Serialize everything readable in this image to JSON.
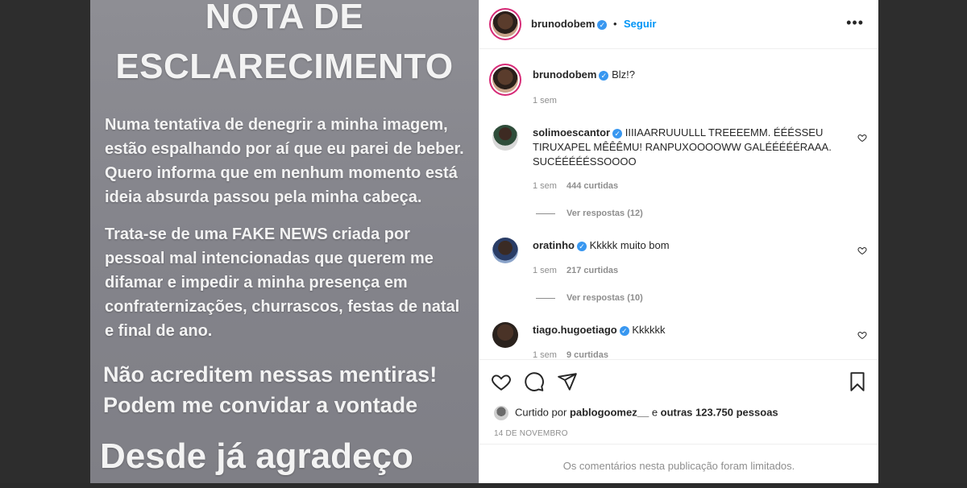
{
  "story": {
    "title_line1": "NOTA DE",
    "title_line2": "ESCLARECIMENTO",
    "paragraph1": "Numa tentativa de denegrir a minha imagem, estão espalhando por aí que eu parei de beber. Quero informa que em nenhum momento está ideia absurda passou pela minha cabeça.",
    "paragraph2": "Trata-se de uma FAKE NEWS criada por pessoal mal intencionadas que querem me difamar e impedir a minha presença em confraternizações, churrascos, festas de natal e final de ano.",
    "paragraph3": "Não acreditem nessas mentiras! Podem me convidar a vontade",
    "paragraph4": "Desde já agradeço"
  },
  "header": {
    "username": "brunodobem",
    "separator": "•",
    "follow_label": "Seguir",
    "more_label": "•••"
  },
  "caption": {
    "username": "brunodobem",
    "text": "Blz!?",
    "time": "1 sem"
  },
  "comments": [
    {
      "username": "solimoescantor",
      "text": "IIIIAARRUUULLL TREEEEMM. ÉÉÉSSEU TIRUXAPEL MÊÊÊMU! RANPUXOOOOWW GALÉÉÉÉÉRAAA. SUCÉÉÉÉÉSSOOOO",
      "time": "1 sem",
      "likes": "444 curtidas",
      "replies": "Ver respostas (12)"
    },
    {
      "username": "oratinho",
      "text": "Kkkkk muito bom",
      "time": "1 sem",
      "likes": "217 curtidas",
      "replies": "Ver respostas (10)"
    },
    {
      "username": "tiago.hugoetiago",
      "text": "Kkkkkk",
      "time": "1 sem",
      "likes": "9 curtidas"
    }
  ],
  "liked_by": {
    "prefix": "Curtido por",
    "user": "pablogoomez__",
    "conj": "e",
    "others": "outras 123.750 pessoas"
  },
  "date": "14 DE NOVEMBRO",
  "comments_limited": "Os comentários nesta publicação foram limitados.",
  "icons": [
    "heart-icon",
    "comment-icon",
    "share-icon",
    "bookmark-icon",
    "verified-icon",
    "more-icon"
  ],
  "colors": {
    "accent": "#0095f6",
    "verified": "#3897f0",
    "muted": "#8e8e8e"
  }
}
